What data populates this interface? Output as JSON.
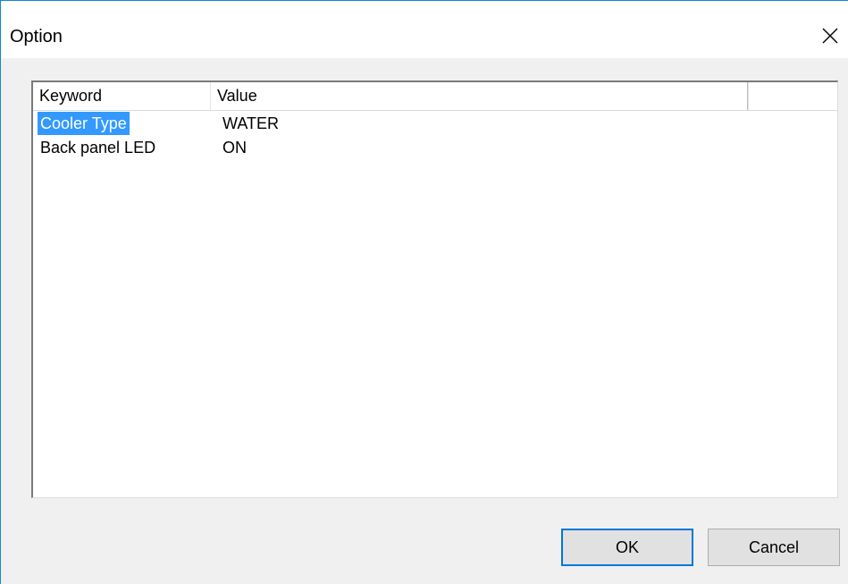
{
  "window": {
    "title": "Option",
    "close_icon": "close-icon"
  },
  "listview": {
    "columns": [
      "Keyword",
      "Value",
      ""
    ],
    "rows": [
      {
        "keyword": "Cooler Type",
        "value": "WATER",
        "selected": true
      },
      {
        "keyword": "Back panel LED",
        "value": "ON",
        "selected": false
      }
    ],
    "selection_color": "#3399ff"
  },
  "buttons": {
    "ok_label": "OK",
    "cancel_label": "Cancel"
  },
  "colors": {
    "accent": "#0078d7",
    "dialog_background": "#f0f0f0"
  }
}
